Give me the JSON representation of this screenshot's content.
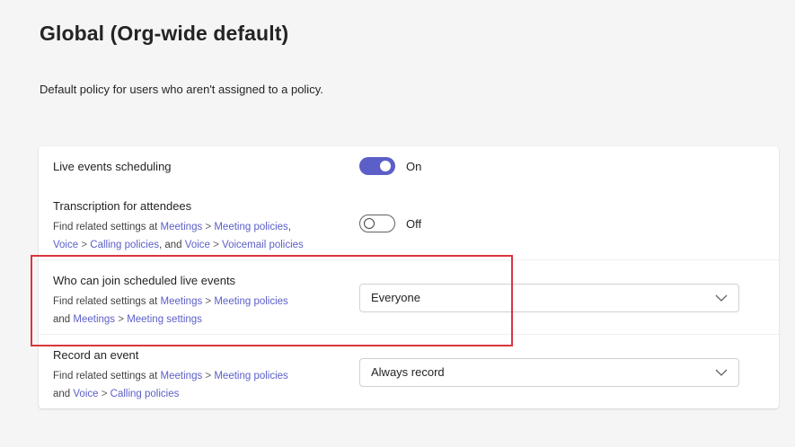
{
  "page": {
    "title": "Global (Org-wide default)",
    "description": "Default policy for users who aren't assigned to a policy."
  },
  "settings": [
    {
      "label": "Live events scheduling",
      "control": "toggle",
      "state": "on",
      "state_label": "On"
    },
    {
      "label": "Transcription for attendees",
      "control": "toggle",
      "state": "off",
      "state_label": "Off",
      "related": {
        "prefix": "Find related settings at",
        "links": [
          {
            "a": "Meetings",
            "b": "Meeting policies"
          },
          {
            "a": "Voice",
            "b": "Calling policies"
          },
          {
            "a": "Voice",
            "b": "Voicemail policies"
          }
        ],
        "and": "and"
      }
    },
    {
      "label": "Who can join scheduled live events",
      "control": "dropdown",
      "value": "Everyone",
      "related": {
        "prefix": "Find related settings at",
        "links": [
          {
            "a": "Meetings",
            "b": "Meeting policies"
          },
          {
            "a": "Meetings",
            "b": "Meeting settings"
          }
        ],
        "and": "and"
      }
    },
    {
      "label": "Record an event",
      "control": "dropdown",
      "value": "Always record",
      "related": {
        "prefix": "Find related settings at",
        "links": [
          {
            "a": "Meetings",
            "b": "Meeting policies"
          },
          {
            "a": "Voice",
            "b": "Calling policies"
          }
        ],
        "and": "and"
      }
    }
  ],
  "separator": ">",
  "colors": {
    "accent": "#5b5fc7",
    "highlight": "#d9363e"
  },
  "icons": {
    "dropdown": "chevron-down-icon"
  }
}
